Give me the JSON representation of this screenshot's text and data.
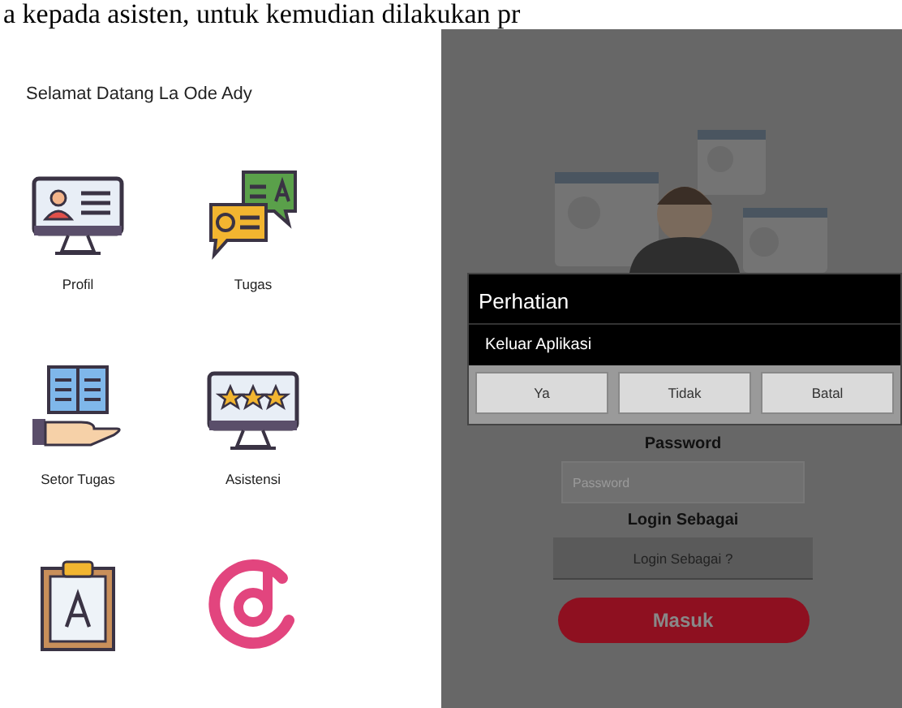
{
  "document_text": "a kepada asisten, untuk kemudian dilakukan pr",
  "home_screen": {
    "greeting": "Selamat Datang La Ode Ady",
    "menu": [
      {
        "kind": "profile",
        "label": "Profil"
      },
      {
        "kind": "qa",
        "label": "Tugas"
      },
      {
        "kind": "book",
        "label": "Setor Tugas"
      },
      {
        "kind": "rating",
        "label": "Asistensi"
      },
      {
        "kind": "clipboard"
      },
      {
        "kind": "music"
      }
    ]
  },
  "login_screen": {
    "dialog": {
      "title": "Perhatian",
      "message": "Keluar Aplikasi",
      "buttons": [
        "Ya",
        "Tidak",
        "Batal"
      ]
    },
    "password_label": "Password",
    "password_field": {
      "placeholder": "Password"
    },
    "role_label": "Login Sebagai",
    "role_select": "Login Sebagai ?",
    "submit_button": "Masuk"
  }
}
